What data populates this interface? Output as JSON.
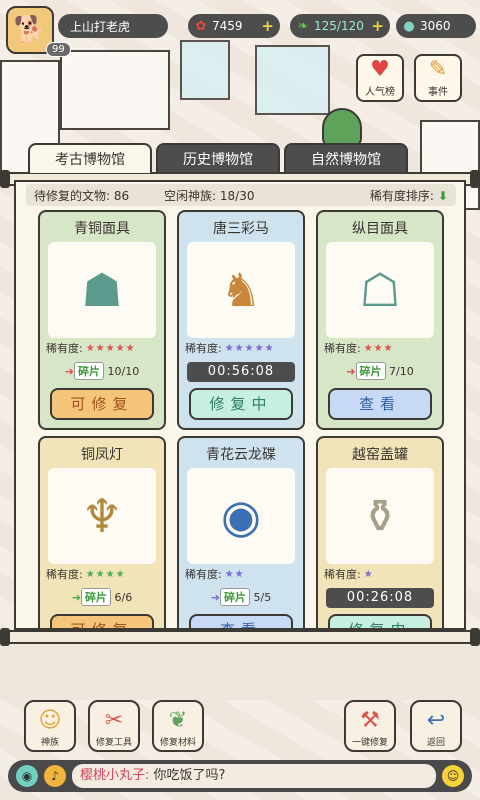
{
  "topbar": {
    "player_name": "上山打老虎",
    "level": "99",
    "gold": "7459",
    "energy": "125/120",
    "gems": "3060"
  },
  "side_buttons": [
    {
      "label": "人气榜",
      "icon": "heart-board-icon"
    },
    {
      "label": "事件",
      "icon": "scroll-event-icon"
    }
  ],
  "tabs": [
    {
      "label": "考古博物馆",
      "active": true
    },
    {
      "label": "历史博物馆",
      "active": false
    },
    {
      "label": "自然博物馆",
      "active": false
    }
  ],
  "info": {
    "pending_label": "待修复的文物:",
    "pending_value": "86",
    "idle_label": "空闲神族:",
    "idle_value": "18/30",
    "sort_label": "稀有度排序:"
  },
  "cards": [
    {
      "title": "青铜面具",
      "icon": "bronze-mask-icon",
      "rarity_label": "稀有度:",
      "stars": "★★★★★",
      "star_color": "#d9534f",
      "fragment_tag": "碎片",
      "fragment_count": "10/10",
      "button": "可修复",
      "button_style": "orange",
      "bg": "green"
    },
    {
      "title": "唐三彩马",
      "icon": "tang-horse-icon",
      "rarity_label": "稀有度:",
      "stars": "★★★★★",
      "star_color": "#7c6bd6",
      "timer": "00:56:08",
      "button": "修复中",
      "button_style": "teal",
      "bg": "blue"
    },
    {
      "title": "纵目面具",
      "icon": "bronze-mask-icon",
      "rarity_label": "稀有度:",
      "stars": "★★★",
      "star_color": "#d9534f",
      "fragment_tag": "碎片",
      "fragment_count": "7/10",
      "button": "查看",
      "button_style": "blue",
      "bg": "green"
    },
    {
      "title": "铜凤灯",
      "icon": "phoenix-lamp-icon",
      "rarity_label": "稀有度:",
      "stars": "★★★★",
      "star_color": "#4caf50",
      "fragment_tag": "碎片",
      "fragment_count": "6/6",
      "button": "可修复",
      "button_style": "orange",
      "bg": "yellow"
    },
    {
      "title": "青花云龙碟",
      "icon": "porcelain-plate-icon",
      "rarity_label": "稀有度:",
      "stars": "★★",
      "star_color": "#7c6bd6",
      "fragment_tag": "碎片",
      "fragment_count": "5/5",
      "button": "查看",
      "button_style": "blue",
      "bg": "blue"
    },
    {
      "title": "越窑盖罐",
      "icon": "covered-jar-icon",
      "rarity_label": "稀有度:",
      "stars": "★",
      "star_color": "#7c6bd6",
      "timer": "00:26:08",
      "button": "修复中",
      "button_style": "teal",
      "bg": "yellow"
    }
  ],
  "bottom_buttons": [
    {
      "label": "神族",
      "icon": "deity-icon"
    },
    {
      "label": "修复工具",
      "icon": "tools-icon"
    },
    {
      "label": "修复材料",
      "icon": "materials-icon"
    },
    {
      "label": "一键修复",
      "icon": "one-click-repair-icon"
    },
    {
      "label": "返回",
      "icon": "back-icon"
    }
  ],
  "chat": {
    "user": "樱桃小丸子:",
    "message": "你吃饭了吗?"
  }
}
